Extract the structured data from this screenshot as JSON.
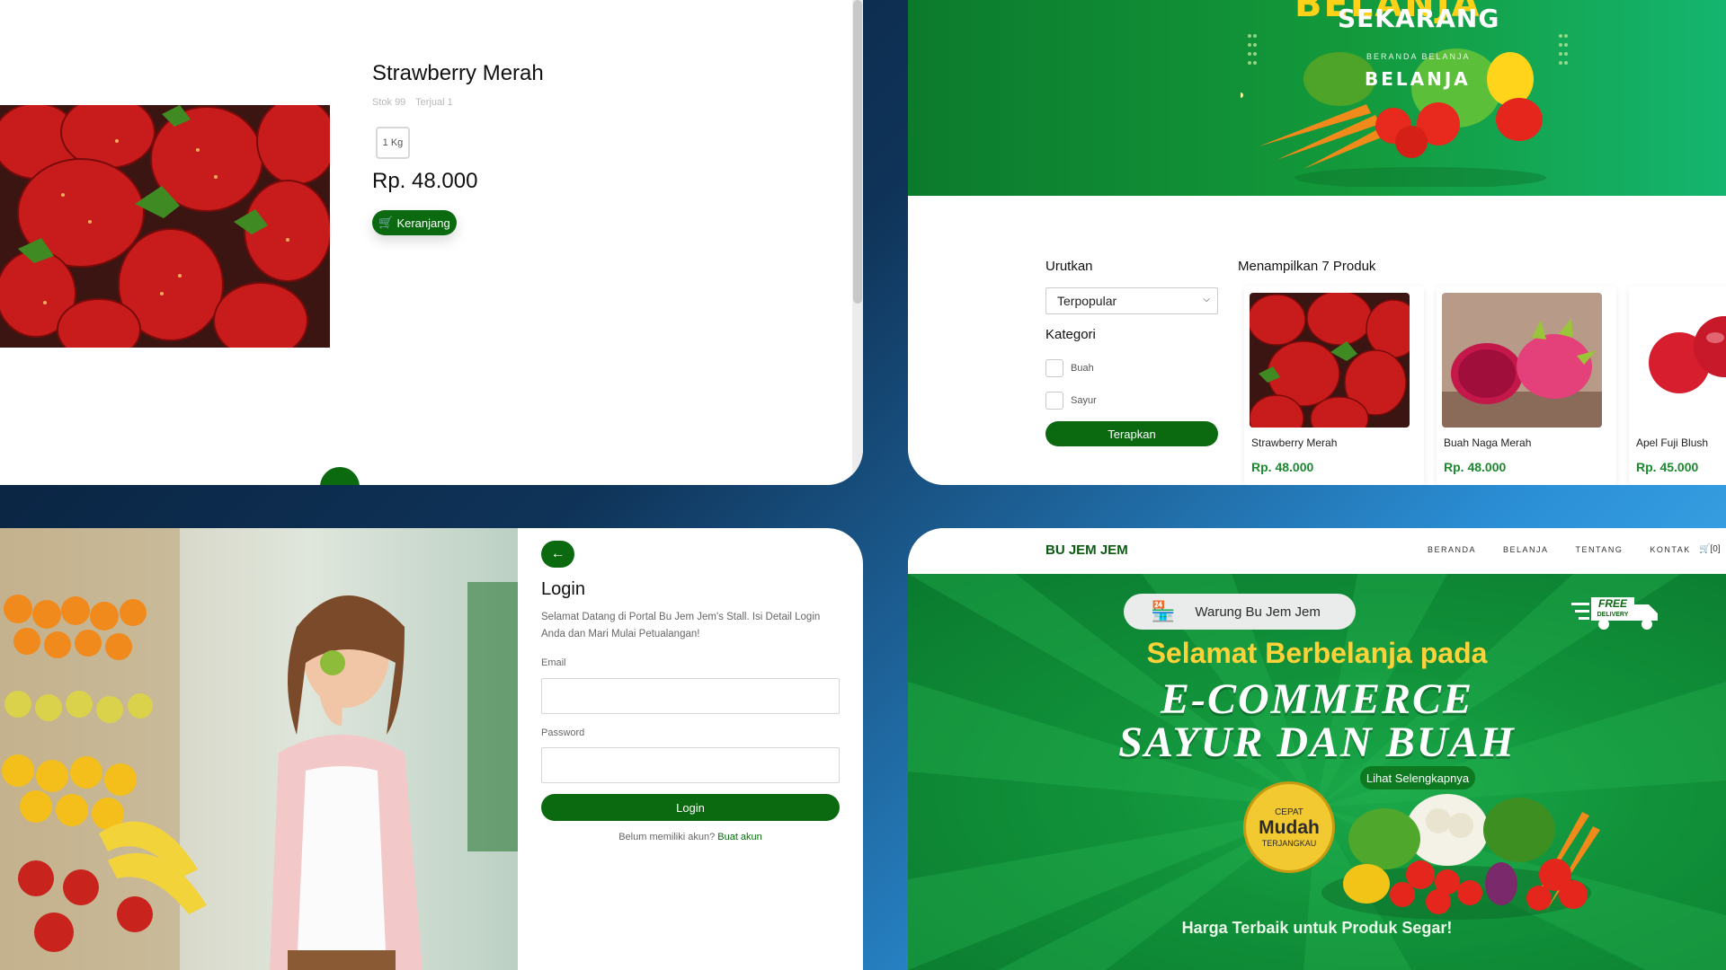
{
  "product_detail": {
    "name": "Strawberry Merah",
    "stock": "Stok 99",
    "sold": "Terjual 1",
    "variant": "1 Kg",
    "price": "Rp. 48.000",
    "cart_button": "Keranjang"
  },
  "shop": {
    "banner": {
      "headline": "BELANJA",
      "subline": "SEKARANG",
      "breadcrumb": "BERANDA  BELANJA",
      "title": "BELANJA"
    },
    "sort_label": "Urutkan",
    "sort_value": "Terpopular",
    "category_label": "Kategori",
    "categories": [
      "Buah",
      "Sayur"
    ],
    "apply_button": "Terapkan",
    "result_count": "Menampilkan 7 Produk",
    "products": [
      {
        "name": "Strawberry Merah",
        "price": "Rp. 48.000"
      },
      {
        "name": "Buah Naga Merah",
        "price": "Rp. 48.000"
      },
      {
        "name": "Apel Fuji Blush",
        "price": "Rp. 45.000"
      }
    ]
  },
  "login": {
    "title": "Login",
    "description": "Selamat Datang di Portal Bu Jem Jem's Stall. Isi Detail Login Anda dan Mari Mulai Petualangan!",
    "email_label": "Email",
    "password_label": "Password",
    "button": "Login",
    "signup_prompt": "Belum memiliki akun?",
    "signup_link": "Buat akun"
  },
  "home": {
    "brand": "BU JEM JEM",
    "nav": [
      "BERANDA",
      "BELANJA",
      "TENTANG",
      "KONTAK"
    ],
    "cart": "[0]",
    "store_pill": "Warung Bu Jem Jem",
    "free_delivery_top": "FREE",
    "free_delivery_bottom": "DELIVERY",
    "line1": "Selamat Berbelanja pada",
    "line2": "E-COMMERCE",
    "line3": "SAYUR DAN BUAH",
    "more_button": "Lihat Selengkapnya",
    "badge_top": "CEPAT",
    "badge_main": "Mudah",
    "badge_bottom": "TERJANGKAU",
    "footer": "Harga Terbaik untuk Produk Segar!"
  },
  "colors": {
    "primary_green": "#0b6a10",
    "price_green": "#1a8a2e",
    "accent_yellow": "#ffd23a"
  }
}
